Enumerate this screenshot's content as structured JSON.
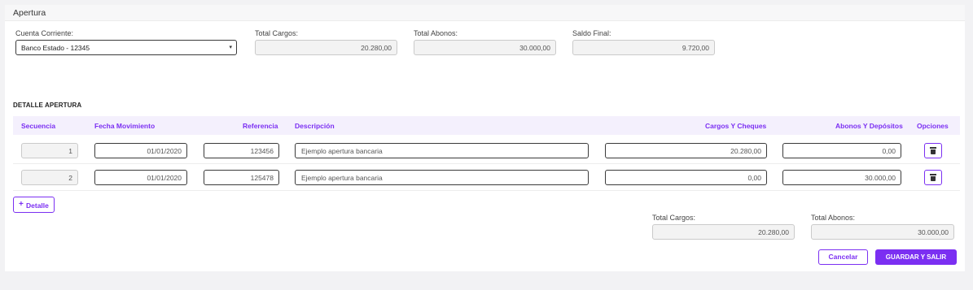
{
  "header": {
    "title": "Apertura"
  },
  "summary": {
    "cuenta_label": "Cuenta Corriente:",
    "cuenta_value": "Banco Estado - 12345",
    "total_cargos_label": "Total Cargos:",
    "total_cargos_value": "20.280,00",
    "total_abonos_label": "Total Abonos:",
    "total_abonos_value": "30.000,00",
    "saldo_label": "Saldo Final:",
    "saldo_value": "9.720,00"
  },
  "detail": {
    "title": "DETALLE APERTURA",
    "columns": [
      "Secuencia",
      "Fecha Movimiento",
      "Referencia",
      "Descripción",
      "Cargos Y Cheques",
      "Abonos Y Depósitos",
      "Opciones"
    ],
    "rows": [
      {
        "secuencia": "1",
        "fecha": "01/01/2020",
        "referencia": "123456",
        "descripcion": "Ejemplo apertura bancaria",
        "cargos": "20.280,00",
        "abonos": "0,00"
      },
      {
        "secuencia": "2",
        "fecha": "01/01/2020",
        "referencia": "125478",
        "descripcion": "Ejemplo apertura bancaria",
        "cargos": "0,00",
        "abonos": "30.000,00"
      }
    ],
    "add_label": "Detalle",
    "add_icon": "plus-icon",
    "delete_icon": "trash-icon"
  },
  "totals": {
    "cargos_label": "Total Cargos:",
    "cargos_value": "20.280,00",
    "abonos_label": "Total Abonos:",
    "abonos_value": "30.000,00"
  },
  "actions": {
    "cancel_label": "Cancelar",
    "save_label": "GUARDAR Y SALIR"
  },
  "colors": {
    "accent": "#7b2ff2",
    "header_bg": "#f4f0fd"
  }
}
